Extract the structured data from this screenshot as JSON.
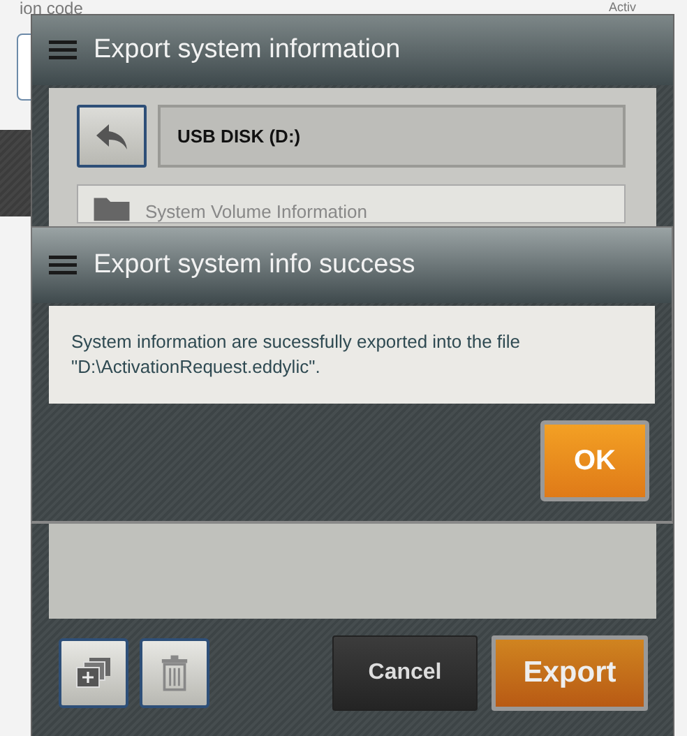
{
  "background": {
    "texts": [
      {
        "text": "ion code",
        "kind": "label"
      },
      {
        "text": "Activ",
        "kind": "tab"
      }
    ]
  },
  "export_dialog": {
    "title": "Export system information",
    "path": "USB DISK (D:)",
    "files": [
      {
        "name": "System Volume Information",
        "kind": "folder"
      }
    ],
    "buttons": [
      {
        "label": "Cancel",
        "kind": "secondary"
      },
      {
        "label": "Export",
        "kind": "primary"
      }
    ]
  },
  "success_dialog": {
    "title": "Export system info success",
    "message": "System information are sucessfully exported into the file \"D:\\ActivationRequest.eddylic\".",
    "button": "OK"
  }
}
